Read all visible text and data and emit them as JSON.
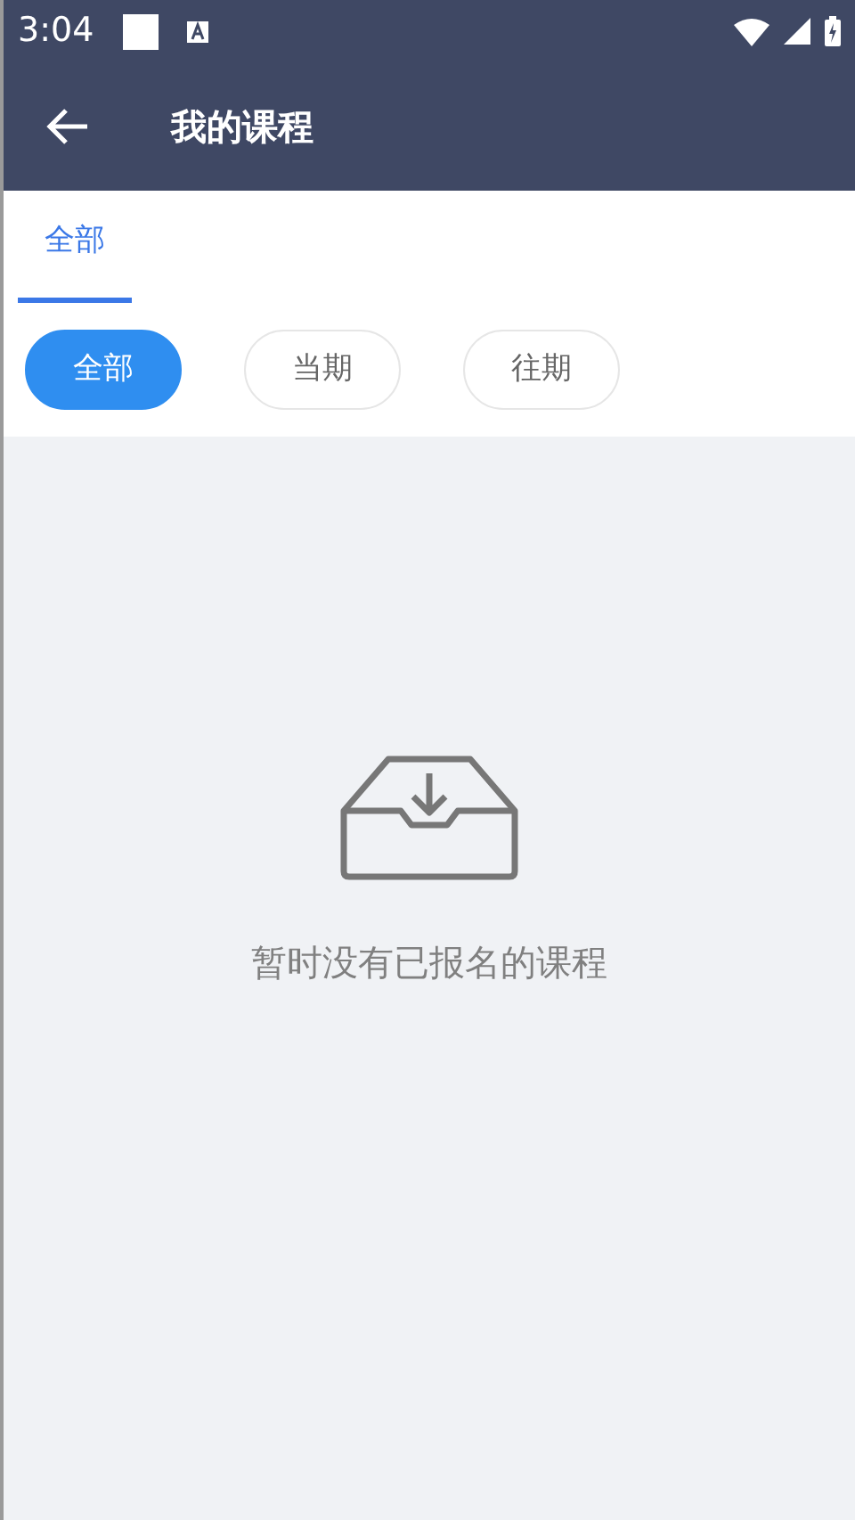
{
  "status_bar": {
    "time": "3:04"
  },
  "header": {
    "title": "我的课程"
  },
  "tabs": [
    {
      "label": "全部",
      "selected": true
    }
  ],
  "filters": [
    {
      "label": "全部",
      "selected": true
    },
    {
      "label": "当期",
      "selected": false
    },
    {
      "label": "往期",
      "selected": false
    }
  ],
  "empty_state": {
    "message": "暂时没有已报名的课程"
  }
}
